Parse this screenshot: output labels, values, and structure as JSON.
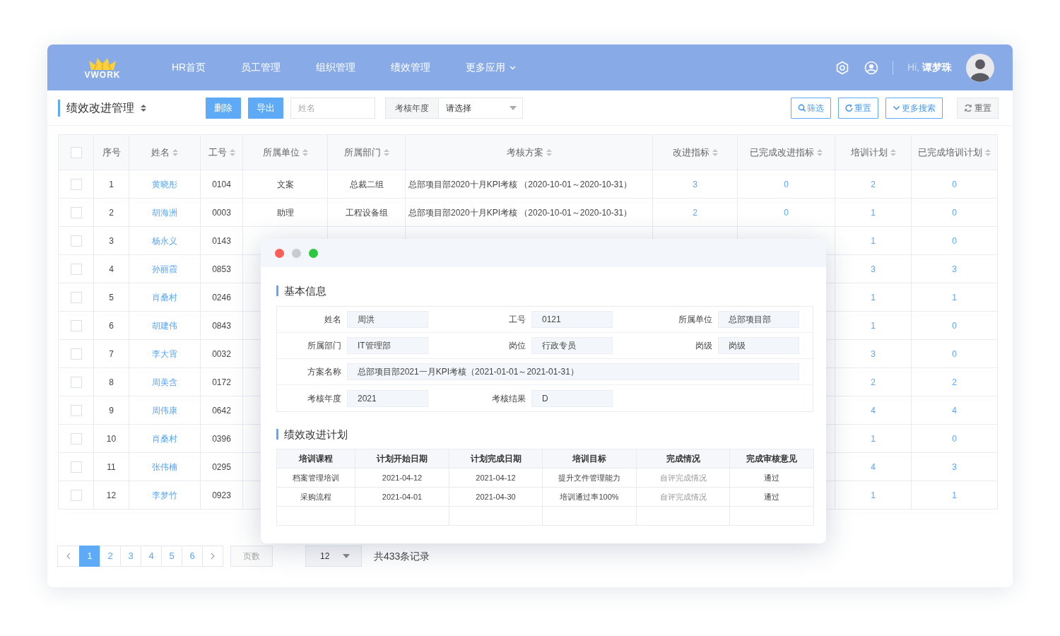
{
  "header": {
    "logo": "VWORK",
    "nav": [
      {
        "label": "HR首页",
        "kind": "link"
      },
      {
        "label": "员工管理",
        "kind": "link"
      },
      {
        "label": "组织管理",
        "kind": "link"
      },
      {
        "label": "绩效管理",
        "kind": "link"
      },
      {
        "label": "更多应用",
        "kind": "dropdown"
      }
    ],
    "greeting": "Hi,",
    "user": "谭梦珠"
  },
  "toolbar": {
    "title": "绩效改进管理",
    "buttons": [
      "删除",
      "导出"
    ],
    "name_field": {
      "placeholder": "姓名"
    },
    "year_filter": {
      "label": "考核年度",
      "value": "请选择"
    },
    "actions": [
      "筛选",
      "重置",
      "更多搜索"
    ],
    "reset": "重置"
  },
  "table": {
    "select_all": {
      "checked": false
    },
    "columns": [
      {
        "label": "序号",
        "sortable": false
      },
      {
        "label": "姓名",
        "sortable": true
      },
      {
        "label": "工号",
        "sortable": true
      },
      {
        "label": "所属单位",
        "sortable": true
      },
      {
        "label": "所属部门",
        "sortable": true
      },
      {
        "label": "考核方案",
        "sortable": true
      },
      {
        "label": "改进指标",
        "sortable": true
      },
      {
        "label": "已完成改进指标",
        "sortable": true
      },
      {
        "label": "培训计划",
        "sortable": true
      },
      {
        "label": "已完成培训计划",
        "sortable": true
      }
    ],
    "rows": [
      {
        "checked": false,
        "no": "1",
        "name": "黄晓彤",
        "id": "0104",
        "unit": "文案",
        "dept": "总裁二组",
        "plan": "总部项目部2020十月KPI考核 （2020-10-01～2020-10-31）",
        "improve": "3",
        "improve_done": "0",
        "training": "2",
        "training_done": "0"
      },
      {
        "checked": false,
        "no": "2",
        "name": "胡海洲",
        "id": "0003",
        "unit": "助理",
        "dept": "工程设备组",
        "plan": "总部项目部2020十月KPI考核 （2020-10-01～2020-10-31）",
        "improve": "2",
        "improve_done": "0",
        "training": "1",
        "training_done": "0"
      },
      {
        "checked": false,
        "no": "3",
        "name": "杨永义",
        "id": "0143",
        "training": "1",
        "training_done": "0"
      },
      {
        "checked": false,
        "no": "4",
        "name": "孙丽霞",
        "id": "0853",
        "training": "3",
        "training_done": "3"
      },
      {
        "checked": false,
        "no": "5",
        "name": "肖桑村",
        "id": "0246",
        "training": "1",
        "training_done": "1"
      },
      {
        "checked": false,
        "no": "6",
        "name": "胡建伟",
        "id": "0843",
        "training": "1",
        "training_done": "0"
      },
      {
        "checked": false,
        "no": "7",
        "name": "李大霄",
        "id": "0032",
        "training": "3",
        "training_done": "0"
      },
      {
        "checked": false,
        "no": "8",
        "name": "周美含",
        "id": "0172",
        "training": "2",
        "training_done": "2"
      },
      {
        "checked": false,
        "no": "9",
        "name": "周伟康",
        "id": "0642",
        "training": "4",
        "training_done": "4"
      },
      {
        "checked": false,
        "no": "10",
        "name": "肖桑村",
        "id": "0396",
        "training": "1",
        "training_done": "0"
      },
      {
        "checked": false,
        "no": "11",
        "name": "张伟楠",
        "id": "0295",
        "training": "4",
        "training_done": "3"
      },
      {
        "checked": false,
        "no": "12",
        "name": "李梦竹",
        "id": "0923",
        "training": "1",
        "training_done": "1"
      }
    ]
  },
  "pagination": {
    "pages": [
      {
        "label": "1",
        "selected": true
      },
      {
        "label": "2",
        "selected": false
      },
      {
        "label": "3",
        "selected": false
      },
      {
        "label": "4",
        "selected": false
      },
      {
        "label": "5",
        "selected": false
      },
      {
        "label": "6",
        "selected": false
      }
    ],
    "page_field": {
      "placeholder": "页数"
    },
    "page_size": "12",
    "total": "共433条记录"
  },
  "modal": {
    "info_title": "基本信息",
    "info_rows": [
      [
        {
          "label": "姓名",
          "value": "周洪"
        },
        {
          "label": "工号",
          "value": "0121"
        },
        {
          "label": "所属单位",
          "value": "总部项目部"
        }
      ],
      [
        {
          "label": "所属部门",
          "value": "IT管理部"
        },
        {
          "label": "岗位",
          "value": "行政专员"
        },
        {
          "label": "岗级",
          "value": "岗级"
        }
      ],
      [
        {
          "label": "方案名称",
          "value": "总部项目部2021一月KPI考核（2021-01-01～2021-01-31）",
          "kind": "wide"
        }
      ],
      [
        {
          "label": "考核年度",
          "value": "2021"
        },
        {
          "label": "考核结果",
          "value": "D"
        }
      ]
    ],
    "plan_title": "绩效改进计划",
    "plan_columns": [
      "培训课程",
      "计划开始日期",
      "计划完成日期",
      "培训目标",
      "完成情况",
      "完成审核意见"
    ],
    "plan_rows": [
      {
        "course": "档案管理培训",
        "start": "2021-04-12",
        "end": "2021-04-12",
        "goal": "提升文件管理能力",
        "status": "自评完成情况",
        "review": "通过"
      },
      {
        "course": "采购流程",
        "start": "2021-04-01",
        "end": "2021-04-30",
        "goal": "培训通过率100%",
        "status": "自评完成情况",
        "review": "通过"
      }
    ]
  }
}
